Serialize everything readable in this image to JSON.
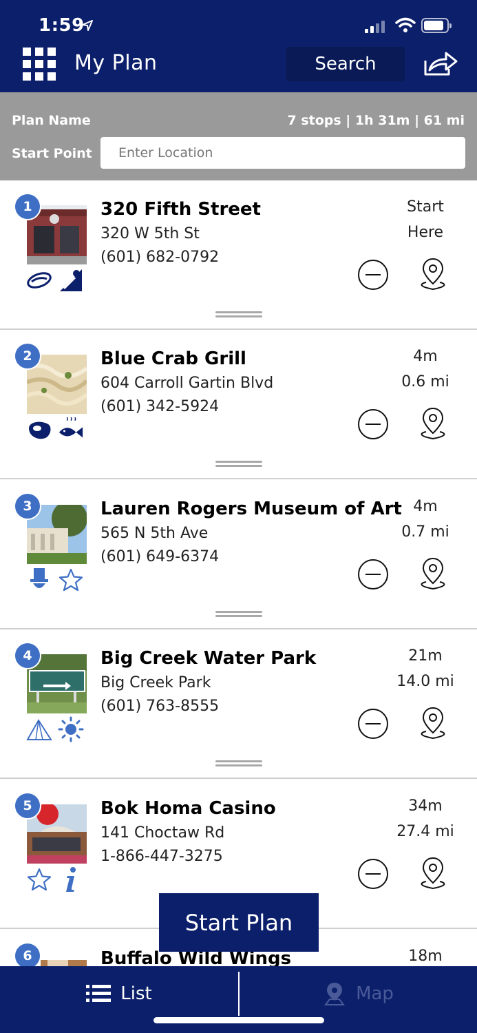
{
  "status_bar": {
    "time": "1:59"
  },
  "header": {
    "title": "My Plan",
    "search_label": "Search"
  },
  "plan": {
    "name_label": "Plan Name",
    "summary": "7 stops | 1h 31m | 61 mi",
    "start_label": "Start Point",
    "start_placeholder": "Enter Location"
  },
  "stops": [
    {
      "number": "1",
      "name": "320 Fifth Street",
      "address": "320 W 5th St",
      "phone": "(601) 682-0792",
      "time": "Start",
      "distance": "Here",
      "icons": [
        "hot-dog-icon",
        "bowling-icon"
      ]
    },
    {
      "number": "2",
      "name": "Blue Crab Grill",
      "address": "604 Carroll Gartin Blvd",
      "phone": "(601) 342-5924",
      "time": "4m",
      "distance": "0.6 mi",
      "icons": [
        "steak-icon",
        "fish-icon"
      ]
    },
    {
      "number": "3",
      "name": "Lauren Rogers Museum of Art",
      "address": "565 N 5th Ave",
      "phone": "(601) 649-6374",
      "time": "4m",
      "distance": "0.7 mi",
      "icons": [
        "top-hat-icon",
        "star-icon"
      ]
    },
    {
      "number": "4",
      "name": "Big Creek Water Park",
      "address": "Big Creek Park",
      "phone": "(601) 763-8555",
      "time": "21m",
      "distance": "14.0 mi",
      "icons": [
        "tent-icon",
        "sun-icon"
      ]
    },
    {
      "number": "5",
      "name": "Bok Homa Casino",
      "address": "141 Choctaw Rd",
      "phone": "1-866-447-3275",
      "time": "34m",
      "distance": "27.4 mi",
      "icons": [
        "star-icon",
        "info-icon"
      ]
    },
    {
      "number": "6",
      "name": "Buffalo Wild Wings",
      "time": "18m"
    }
  ],
  "start_plan_label": "Start Plan",
  "tabs": {
    "list": "List",
    "map": "Map"
  },
  "colors": {
    "navy": "#0c1f6b",
    "badge_blue": "#3f6fc4",
    "gray_bar": "#9a9a9a"
  }
}
